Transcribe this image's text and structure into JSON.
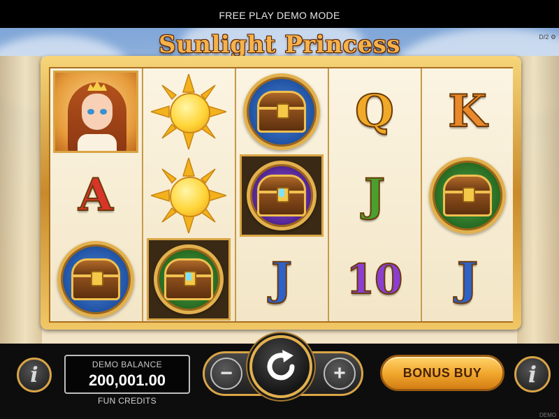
{
  "topbar": {
    "mode_text": "FREE PLAY DEMO MODE"
  },
  "game": {
    "title": "Sunlight Princess",
    "corner_tag": "D/2 ⚙",
    "corner_tag_bottom": "DEMO"
  },
  "reels": {
    "symbols": [
      [
        "princess",
        "A",
        "chest-blue"
      ],
      [
        "sun",
        "sun",
        "chest-green-framed"
      ],
      [
        "chest-blue",
        "chest-purple-framed",
        "J"
      ],
      [
        "Q",
        "J",
        "10"
      ],
      [
        "K",
        "chest-green",
        "J"
      ]
    ],
    "letters": {
      "r0c1": "A",
      "r2c2": "J",
      "r3c0": "Q",
      "r3c1": "J",
      "r3c2": "10",
      "r4c0": "K",
      "r4c2": "J"
    }
  },
  "controls": {
    "info_left": "i",
    "balance_label": "DEMO BALANCE",
    "balance_value": "200,001.00",
    "balance_caption": "FUN CREDITS",
    "minus_label": "−",
    "plus_label": "+",
    "bonus_buy_label": "BONUS BUY",
    "info_right": "i"
  },
  "colors": {
    "accent_gold": "#d9a546",
    "button_orange": "#f0a52a",
    "background_bar": "#0d0d0d"
  }
}
